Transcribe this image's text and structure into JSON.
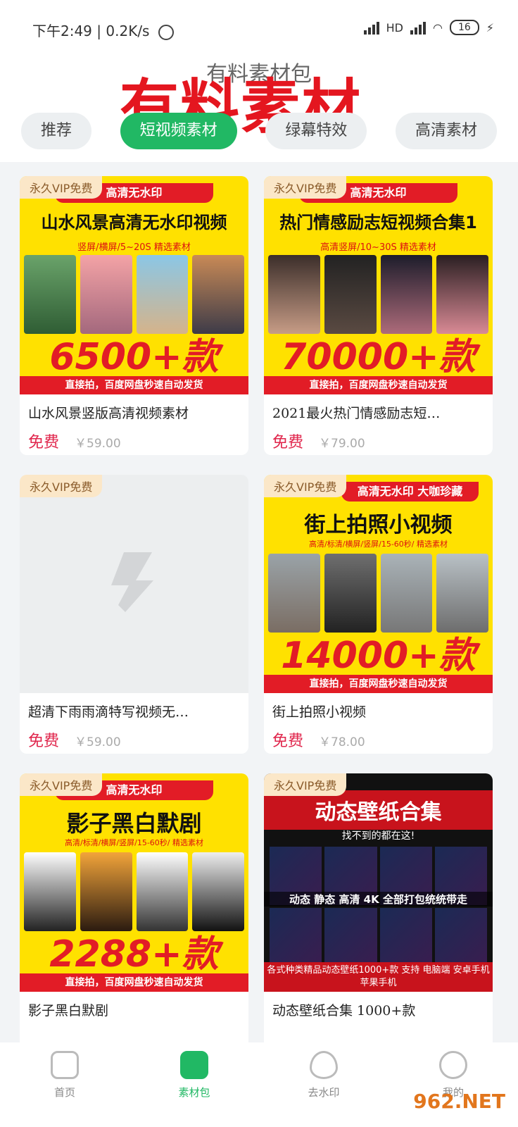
{
  "status_bar": {
    "time": "下午2:49",
    "speed": "0.2K/s",
    "battery": "16",
    "network": "HD"
  },
  "header": {
    "title": "有料素材包",
    "overlay_title": "有料素材"
  },
  "tabs": [
    {
      "label": "推荐",
      "active": false
    },
    {
      "label": "短视频素材",
      "active": true
    },
    {
      "label": "绿幕特效",
      "active": false
    },
    {
      "label": "高清素材",
      "active": false
    }
  ],
  "cards": [
    {
      "vip": "永久VIP免费",
      "banner": "高清无水印",
      "headline": "山水风景高清无水印视频",
      "sub": "竖屏/横屏/5~20S   精选素材",
      "count": "6500+款",
      "footer": "直接拍，百度网盘秒速自动发货",
      "name": "山水风景竖版高清视频素材",
      "price": "免费",
      "original_price": "￥59.00"
    },
    {
      "vip": "永久VIP免费",
      "banner": "高清无水印",
      "headline": "热门情感励志短视频合集1",
      "sub": "高清竖屏/10~30S   精选素材",
      "count": "70000+款",
      "footer": "直接拍，百度网盘秒速自动发货",
      "name": "2021最火热门情感励志短…",
      "price": "免费",
      "original_price": "￥79.00"
    },
    {
      "vip": "永久VIP免费",
      "name": "超清下雨雨滴特写视频无…",
      "price": "免费",
      "original_price": "￥59.00"
    },
    {
      "vip": "永久VIP免费",
      "banner": "高清无水印  大咖珍藏",
      "headline": "街上拍照小视频",
      "sub": "高清/标清/横屏/竖屏/15-60秒/   精选素材",
      "count": "14000+款",
      "footer": "直接拍，百度网盘秒速自动发货",
      "name": "街上拍照小视频",
      "price": "免费",
      "original_price": "￥78.00"
    },
    {
      "vip": "永久VIP免费",
      "banner": "高清无水印",
      "headline": "影子黑白默剧",
      "sub": "高清/标清/横屏/竖屏/15-60秒/   精选素材",
      "count": "2288+款",
      "footer": "直接拍，百度网盘秒速自动发货",
      "name": "影子黑白默剧"
    },
    {
      "vip": "永久VIP免费",
      "headline": "动态壁纸合集",
      "sub": "找不到的都在这!",
      "band": "动态 静态 高清 4K 全部打包统统带走",
      "footer": "各式种类精品动态壁纸1000+款  支持 电脑端 安卓手机 苹果手机",
      "name": "动态壁纸合集  1000+款"
    }
  ],
  "nav": [
    {
      "label": "首页",
      "active": false
    },
    {
      "label": "素材包",
      "active": true
    },
    {
      "label": "去水印",
      "active": false
    },
    {
      "label": "我的",
      "active": false
    }
  ],
  "watermark": "962.NET",
  "colors": {
    "accent": "#21b864",
    "price_red": "#e0264c",
    "banner_red": "#e21c26",
    "poster_yellow": "#ffe100"
  }
}
